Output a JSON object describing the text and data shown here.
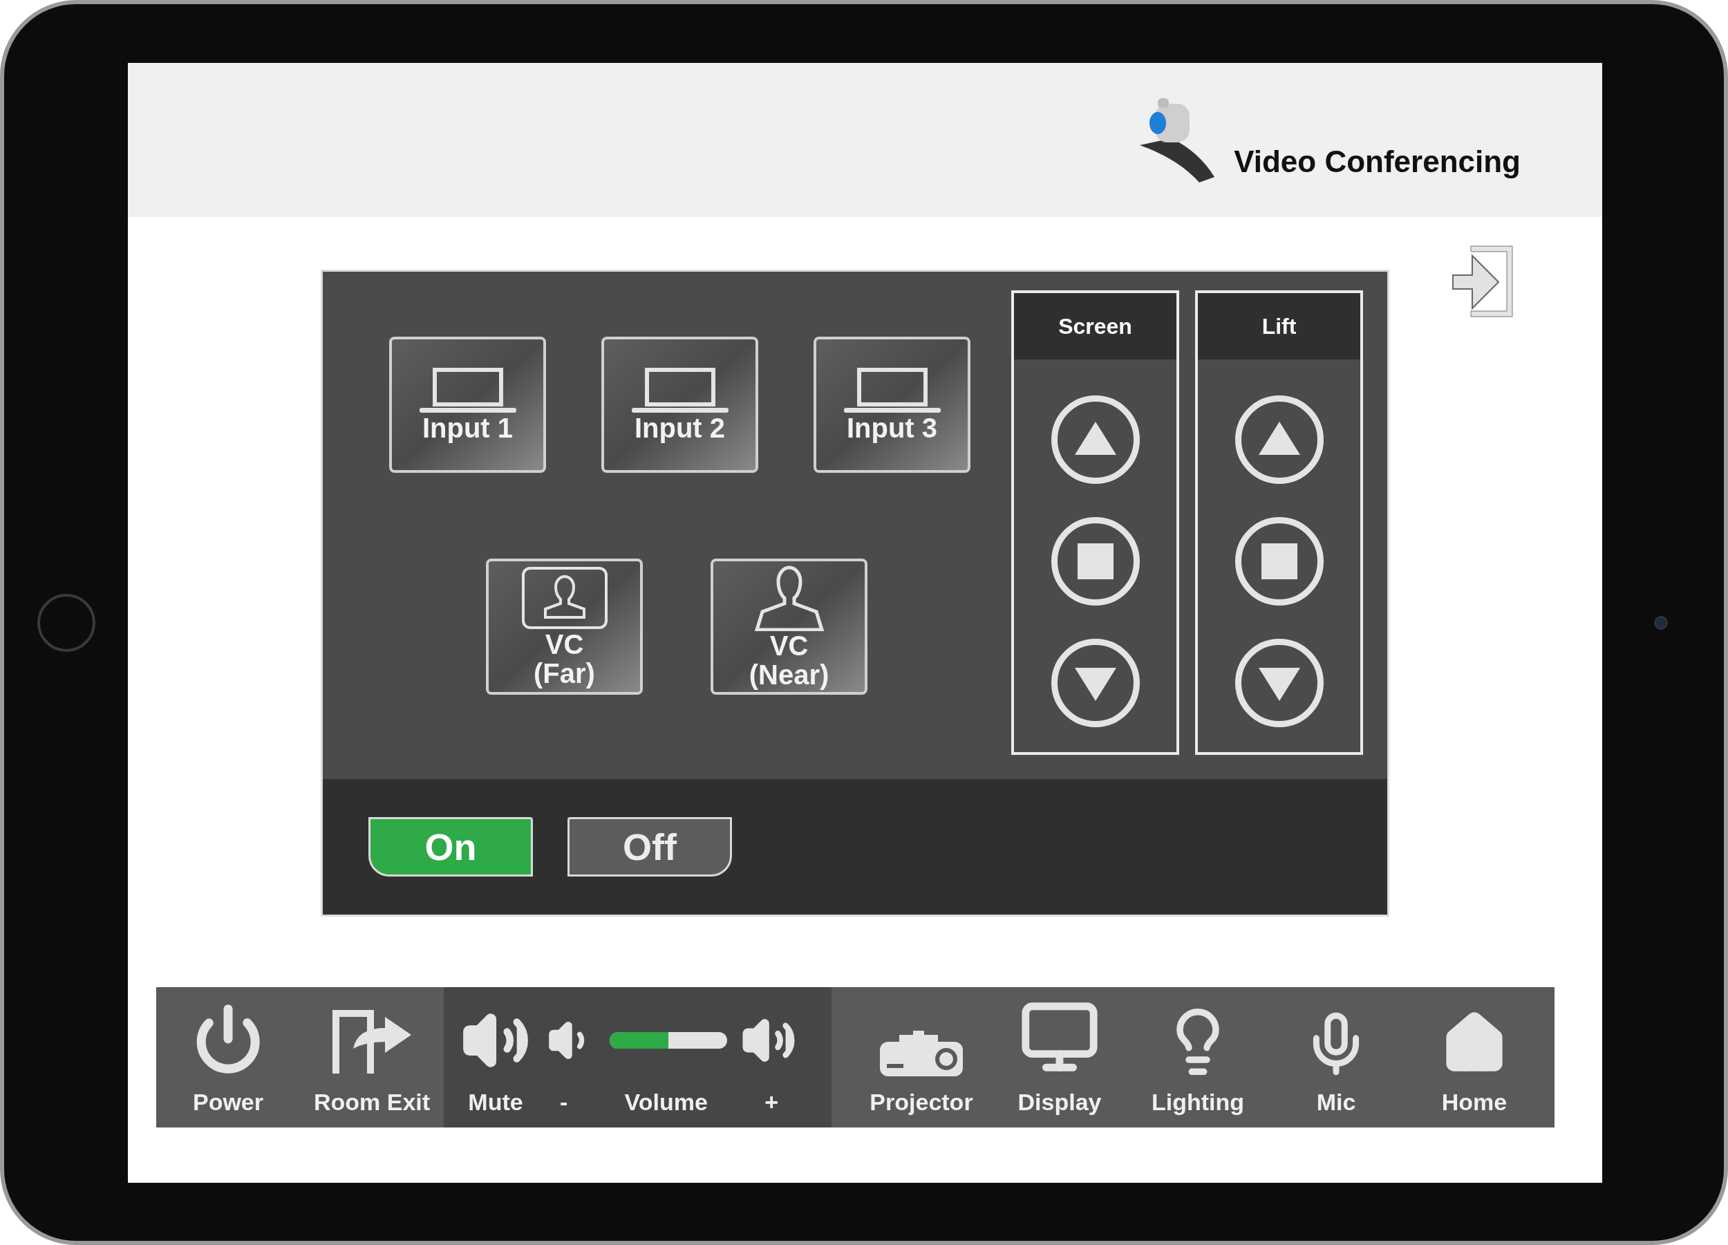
{
  "header": {
    "title": "Video Conferencing"
  },
  "sources": [
    {
      "kind": "laptop",
      "lines": [
        "Input 1"
      ]
    },
    {
      "kind": "laptop",
      "lines": [
        "Input 2"
      ]
    },
    {
      "kind": "laptop",
      "lines": [
        "Input 3"
      ]
    },
    {
      "kind": "vc-far",
      "lines": [
        "VC",
        "(Far)"
      ]
    },
    {
      "kind": "vc-near",
      "lines": [
        "VC",
        "(Near)"
      ]
    }
  ],
  "motor_controls": [
    {
      "title": "Screen"
    },
    {
      "title": "Lift"
    }
  ],
  "power_toggle": [
    {
      "label": "On",
      "selected": true
    },
    {
      "label": "Off",
      "selected": false
    }
  ],
  "bottom_bar": {
    "power": "Power",
    "room_exit": "Room Exit",
    "mute": "Mute",
    "volume_down": "-",
    "volume": {
      "label": "Volume",
      "level": 0.5
    },
    "volume_up": "+",
    "nav": [
      {
        "kind": "projector",
        "label": "Projector"
      },
      {
        "kind": "display",
        "label": "Display"
      },
      {
        "kind": "lighting",
        "label": "Lighting"
      },
      {
        "kind": "mic",
        "label": "Mic"
      },
      {
        "kind": "home",
        "label": "Home"
      }
    ]
  }
}
